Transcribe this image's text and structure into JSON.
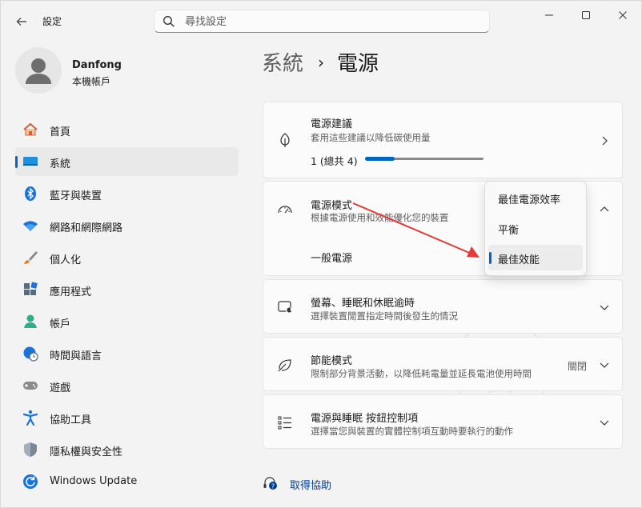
{
  "window": {
    "app_title": "設定",
    "search_placeholder": "尋找設定"
  },
  "profile": {
    "name": "Danfong",
    "account_type": "本機帳戶"
  },
  "nav": [
    {
      "label": "首頁",
      "icon": "home-icon",
      "active": false
    },
    {
      "label": "系統",
      "icon": "system-icon",
      "active": true
    },
    {
      "label": "藍牙與裝置",
      "icon": "bluetooth-icon",
      "active": false
    },
    {
      "label": "網路和網際網路",
      "icon": "wifi-icon",
      "active": false
    },
    {
      "label": "個人化",
      "icon": "brush-icon",
      "active": false
    },
    {
      "label": "應用程式",
      "icon": "apps-icon",
      "active": false
    },
    {
      "label": "帳戶",
      "icon": "account-icon",
      "active": false
    },
    {
      "label": "時間與語言",
      "icon": "clock-globe-icon",
      "active": false
    },
    {
      "label": "遊戲",
      "icon": "gamepad-icon",
      "active": false
    },
    {
      "label": "協助工具",
      "icon": "accessibility-icon",
      "active": false
    },
    {
      "label": "隱私權與安全性",
      "icon": "shield-icon",
      "active": false
    },
    {
      "label": "Windows Update",
      "icon": "update-icon",
      "active": false
    }
  ],
  "breadcrumb": {
    "parent": "系統",
    "separator": "›",
    "current": "電源"
  },
  "power_recommendations": {
    "title": "電源建議",
    "desc": "套用這些建議以降低碳使用量",
    "progress_text": "1 (總共 4)",
    "progress_fraction": 0.25
  },
  "power_mode": {
    "title": "電源模式",
    "desc": "根據電源使用和效能優化您的裝置",
    "sub_label": "一般電源",
    "options": [
      "最佳電源效率",
      "平衡",
      "最佳效能"
    ],
    "selected_option": "最佳效能"
  },
  "screen_sleep": {
    "title": "螢幕、睡眠和休眠逾時",
    "desc": "選擇裝置閒置指定時間後發生的情況"
  },
  "energy_saver": {
    "title": "節能模式",
    "desc": "限制部分背景活動，以降低耗電量並延長電池使用時間",
    "state": "關閉"
  },
  "power_buttons": {
    "title": "電源與睡眠 按鈕控制項",
    "desc": "選擇當您與裝置的實體控制項互動時要執行的動作"
  },
  "help": {
    "label": "取得協助"
  },
  "colors": {
    "accent": "#0067c0",
    "annotation_arrow": "#e53935"
  }
}
